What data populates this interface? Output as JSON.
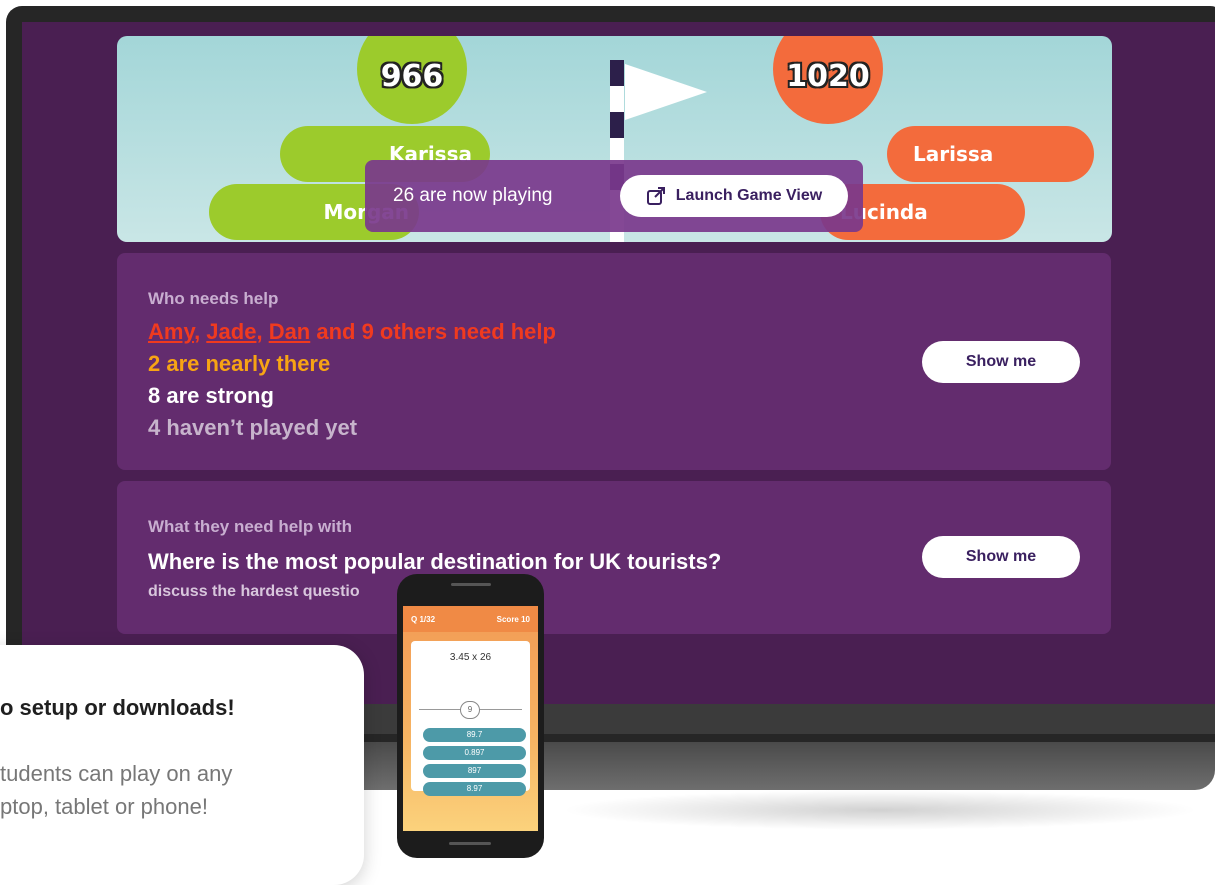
{
  "game": {
    "left_score": "966",
    "right_score": "1020",
    "players_left": [
      "Karissa",
      "Morgan"
    ],
    "players_right": [
      "Larissa",
      "Lucinda"
    ],
    "playing_text": "26 are now playing",
    "launch_label": "Launch Game View"
  },
  "help": {
    "label": "Who needs help",
    "names": [
      "Amy",
      "Jade",
      "Dan"
    ],
    "sep1": ", ",
    "sep2": ", ",
    "others_text": " and 9 others need help",
    "nearly": "2 are nearly there",
    "strong": "8 are strong",
    "not_played": "4 haven’t played yet",
    "show_label": "Show me"
  },
  "what": {
    "label": "What they need help with",
    "question": "Where is the most popular destination for UK tourists?",
    "discuss": "discuss the hardest questio",
    "show_label": "Show me"
  },
  "bubble": {
    "title": "o setup or downloads!",
    "line1": "tudents can play on any",
    "line2": "ptop, tablet or phone!"
  },
  "phone": {
    "question_no": "Q 1/32",
    "score": "Score 10",
    "expression": "3.45 x 26",
    "slider_value": "9",
    "answers": [
      "89.7",
      "0.897",
      "897",
      "8.97"
    ]
  },
  "colors": {
    "screen_bg": "#4a1f52",
    "card_bg": "#632c6e",
    "green": "#9ccb2c",
    "orange": "#f36b3c",
    "red_text": "#f03a1f",
    "orange_text": "#f7a414"
  }
}
